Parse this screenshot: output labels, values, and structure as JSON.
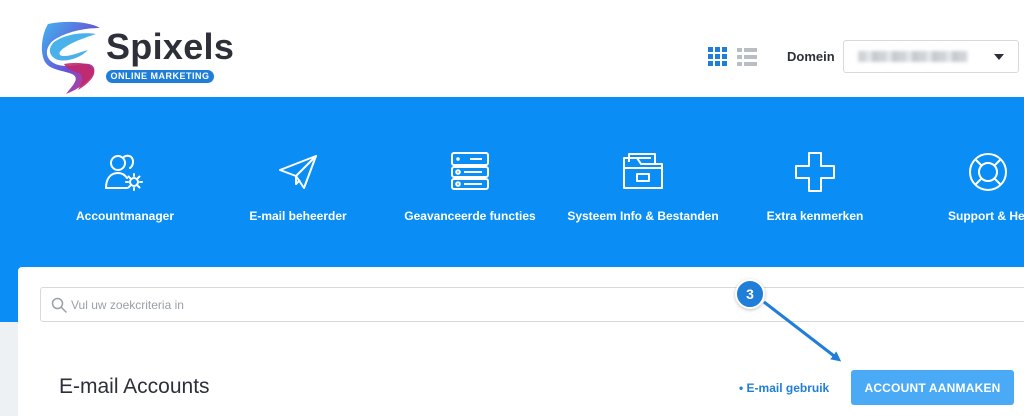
{
  "brand": {
    "name": "Spixels",
    "tagline": "ONLINE MARKETING",
    "colors": {
      "blue": "#1f7fd8",
      "band": "#0a8ef5",
      "pink": "#e8326e"
    }
  },
  "header": {
    "view_grid_icon": "grid-view-icon",
    "view_list_icon": "list-view-icon",
    "domain_label": "Domein",
    "domain_value": "••••••••••••••"
  },
  "nav": {
    "items": [
      {
        "label": "Accountmanager",
        "icon": "users-gear-icon"
      },
      {
        "label": "E-mail beheerder",
        "icon": "paper-plane-icon"
      },
      {
        "label": "Geavanceerde functies",
        "icon": "server-icon"
      },
      {
        "label": "Systeem Info & Bestanden",
        "icon": "folder-icon"
      },
      {
        "label": "Extra kenmerken",
        "icon": "plus-icon"
      },
      {
        "label": "Support & Hel",
        "icon": "lifebuoy-icon"
      }
    ]
  },
  "search": {
    "placeholder": "Vul uw zoekcriteria in",
    "value": ""
  },
  "main": {
    "title": "E-mail Accounts",
    "usage_link": "• E-mail gebruik",
    "create_button": "ACCOUNT AANMAKEN"
  },
  "annotation": {
    "step": "3"
  }
}
